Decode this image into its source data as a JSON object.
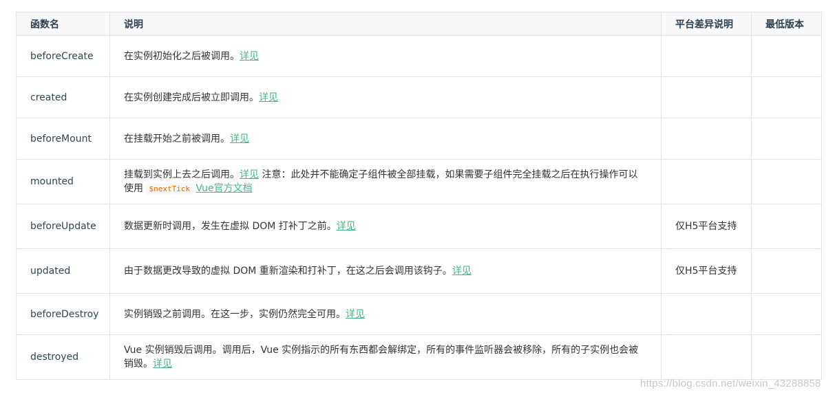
{
  "table": {
    "headers": [
      "函数名",
      "说明",
      "平台差异说明",
      "最低版本"
    ],
    "rows": [
      {
        "name": "beforeCreate",
        "desc": "在实例初始化之后被调用。",
        "link": "详见",
        "platform": "",
        "version": ""
      },
      {
        "name": "created",
        "desc": "在实例创建完成后被立即调用。",
        "link": "详见",
        "platform": "",
        "version": ""
      },
      {
        "name": "beforeMount",
        "desc": "在挂载开始之前被调用。",
        "link": "详见",
        "platform": "",
        "version": ""
      },
      {
        "name": "mounted",
        "desc": "挂载到实例上去之后调用。",
        "link": "详见",
        "note": " 注意：此处并不能确定子组件被全部挂载，如果需要子组件完全挂载之后在执行操作可以使用 ",
        "code": "$nextTick",
        "doc_link": "Vue官方文档",
        "platform": "",
        "version": ""
      },
      {
        "name": "beforeUpdate",
        "desc": "数据更新时调用，发生在虚拟 DOM 打补丁之前。",
        "link": "详见",
        "platform": "仅H5平台支持",
        "version": ""
      },
      {
        "name": "updated",
        "desc": "由于数据更改导致的虚拟 DOM 重新渲染和打补丁，在这之后会调用该钩子。",
        "link": "详见",
        "platform": "仅H5平台支持",
        "version": ""
      },
      {
        "name": "beforeDestroy",
        "desc": "实例销毁之前调用。在这一步，实例仍然完全可用。",
        "link": "详见",
        "platform": "",
        "version": ""
      },
      {
        "name": "destroyed",
        "desc": "Vue 实例销毁后调用。调用后，Vue 实例指示的所有东西都会解绑定，所有的事件监听器会被移除，所有的子实例也会被销毁。",
        "link": "详见",
        "platform": "",
        "version": ""
      }
    ]
  },
  "watermark": "https://blog.csdn.net/weixin_43288858"
}
